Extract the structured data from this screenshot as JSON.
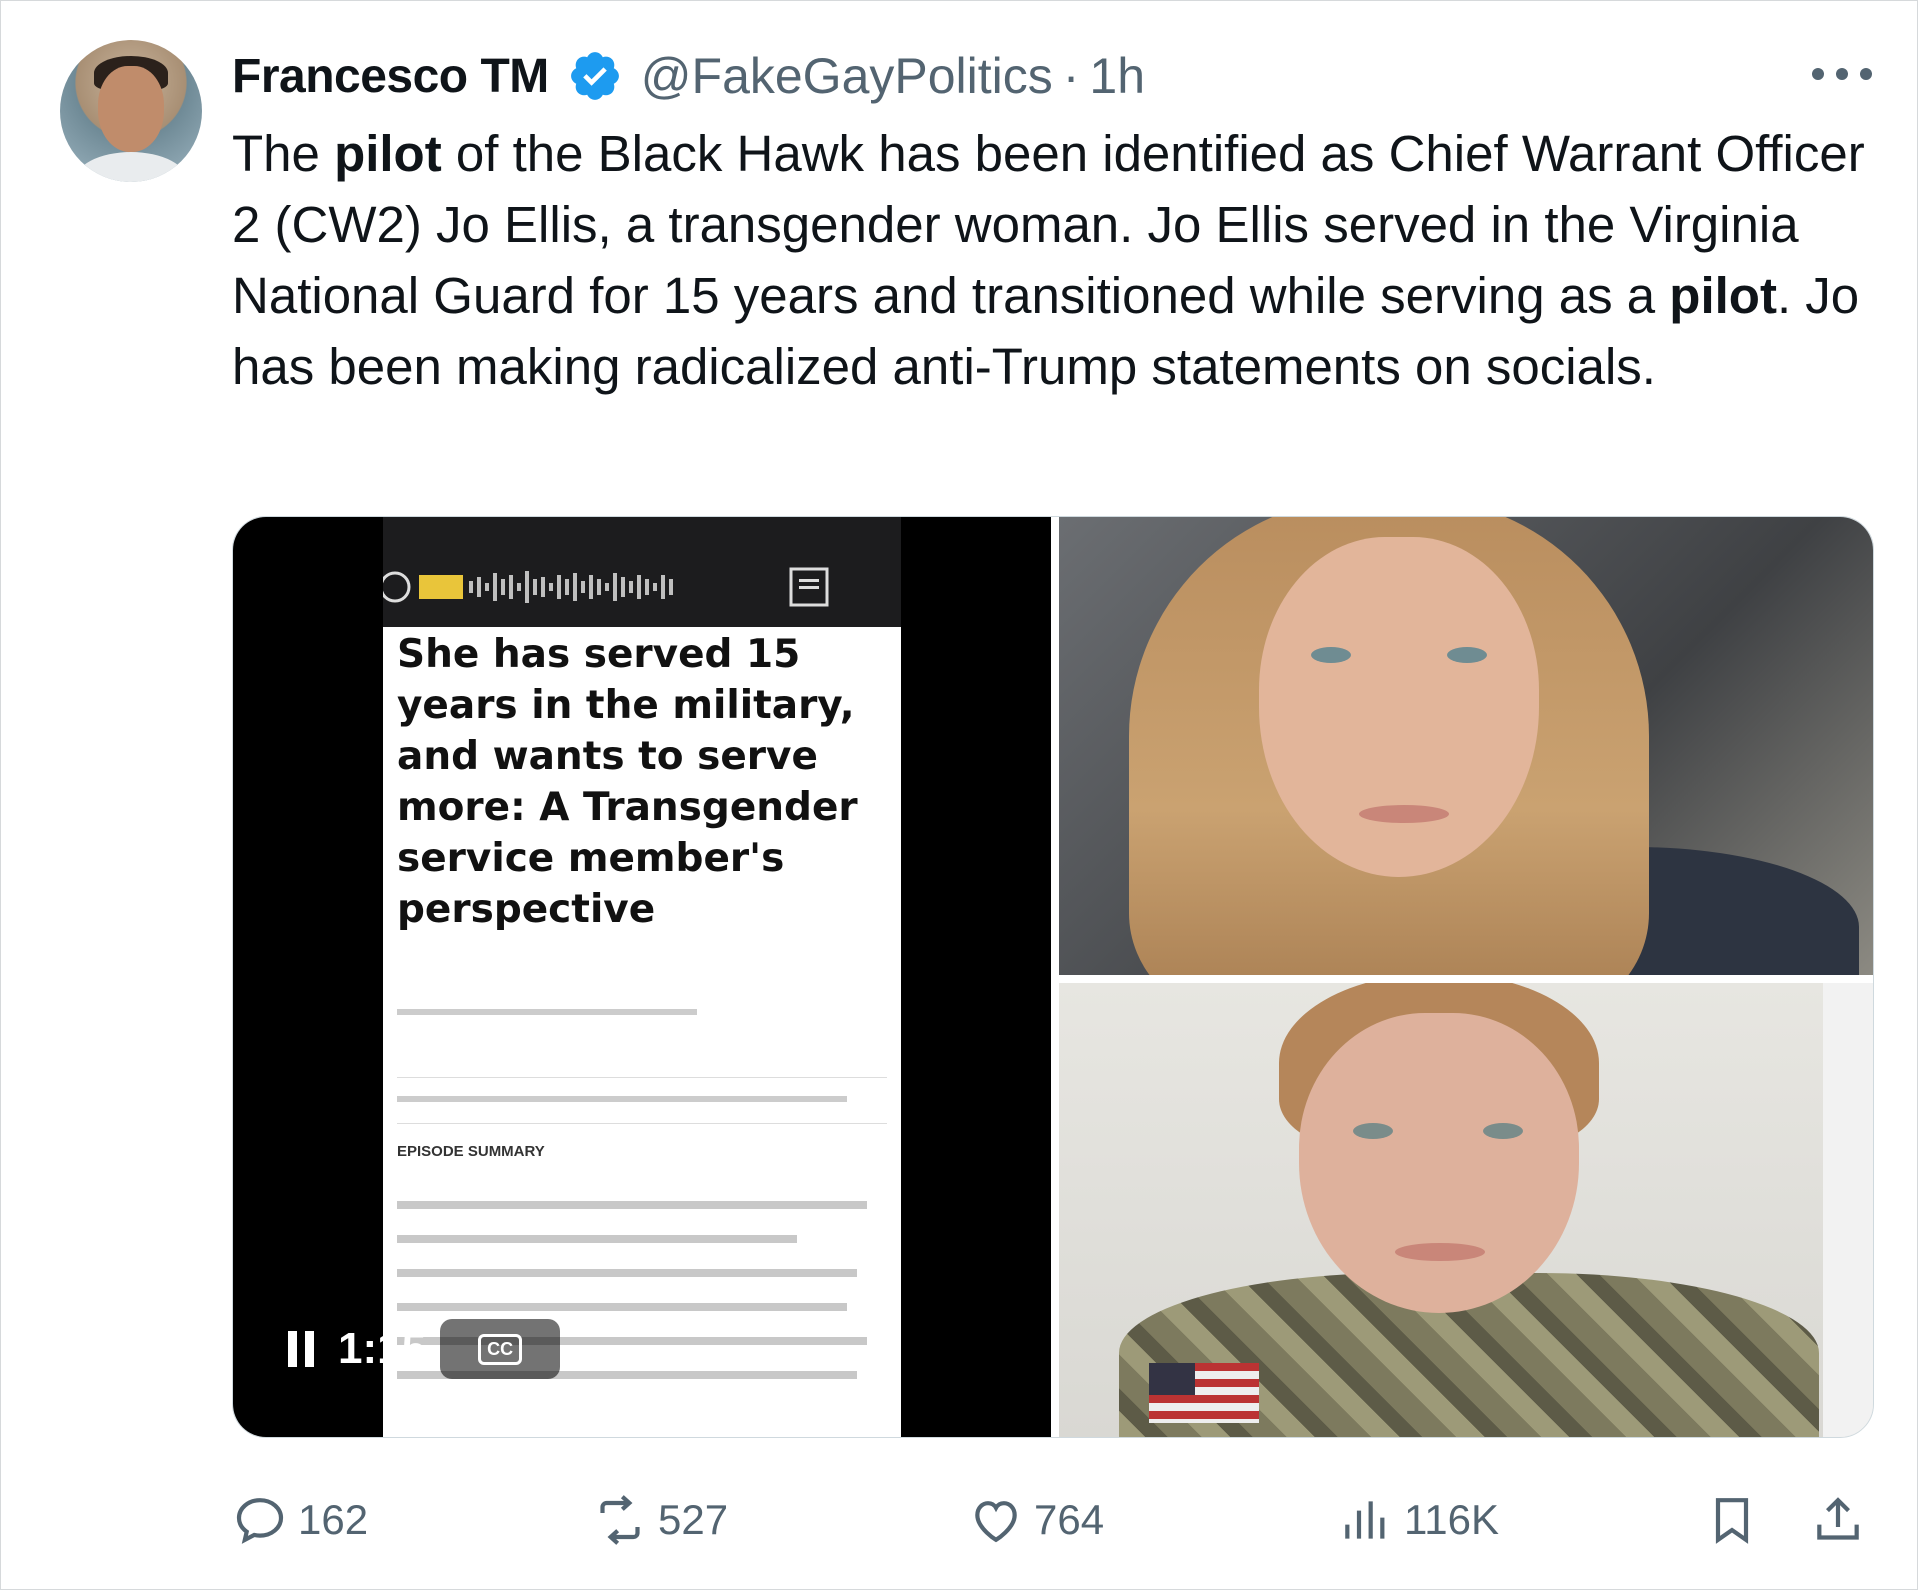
{
  "tweet": {
    "author_name": "Francesco TM",
    "handle": "@FakeGayPolitics",
    "separator": "·",
    "time": "1h",
    "text_parts": [
      {
        "t": "The ",
        "b": false
      },
      {
        "t": "pilot",
        "b": true
      },
      {
        "t": " of the Black Hawk has been identified as Chief Warrant Officer 2 (CW2) Jo Ellis, a transgender woman. Jo Ellis served in the Virginia National Guard for 15 years and transitioned while serving as a ",
        "b": false
      },
      {
        "t": "pilot",
        "b": true
      },
      {
        "t": ". Jo has been making radicalized anti-Trump statements on socials.",
        "b": false
      }
    ]
  },
  "media": {
    "video": {
      "headline": "She has served 15 years in the military, and wants to serve more: A Transgender service member's perspective",
      "time": "1:15",
      "cc_label": "CC",
      "episode_title": "EPISODE SUMMARY"
    }
  },
  "actions": {
    "replies": "162",
    "retweets": "527",
    "likes": "764",
    "views": "116K"
  },
  "colors": {
    "text": "#0f1419",
    "secondary": "#536471",
    "verified": "#1d9bf0"
  },
  "icons": [
    "more-icon",
    "verified-badge-icon",
    "reply-icon",
    "retweet-icon",
    "like-icon",
    "views-icon",
    "bookmark-icon",
    "share-icon",
    "pause-icon",
    "cc-icon"
  ]
}
